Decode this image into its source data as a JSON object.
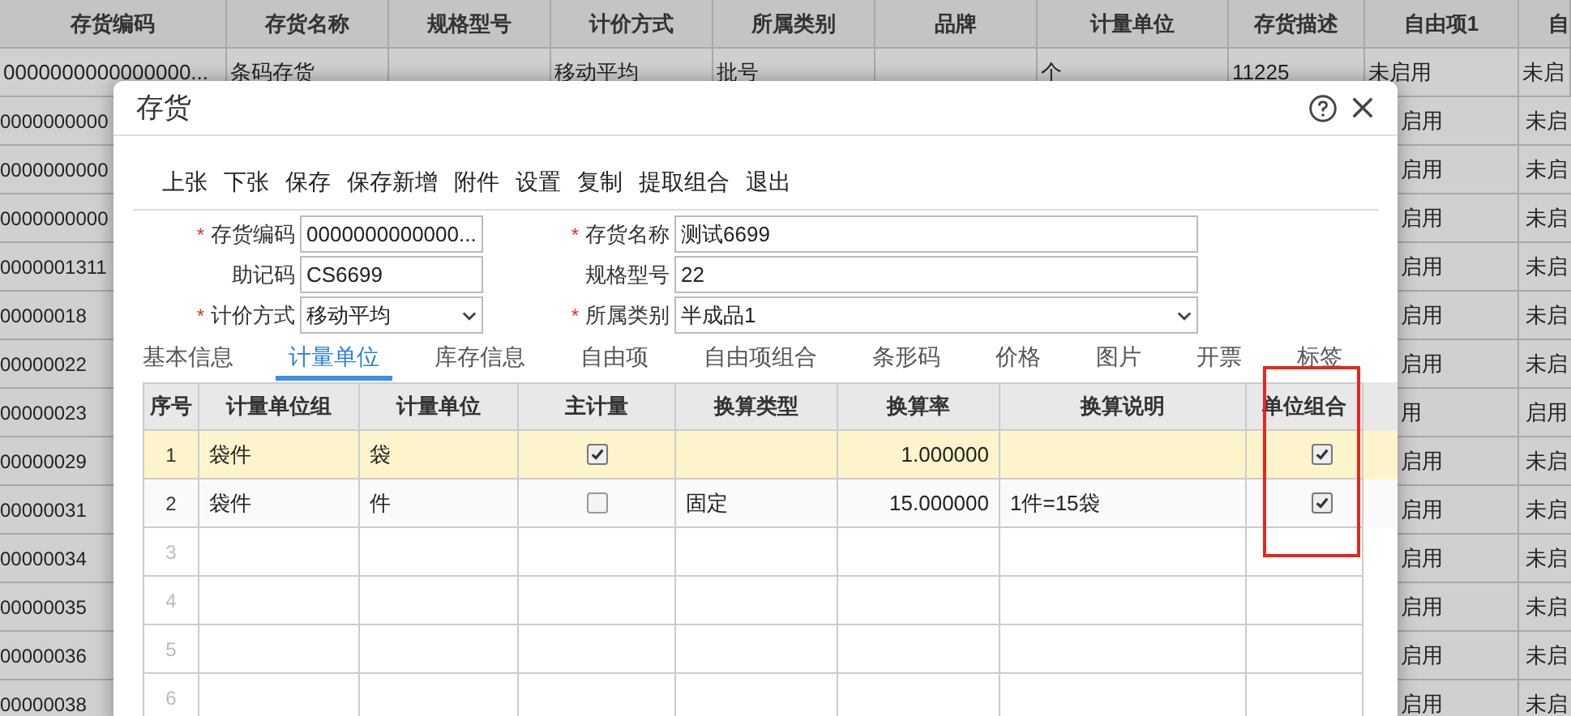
{
  "background_table": {
    "columns": [
      "存货编码",
      "存货名称",
      "规格型号",
      "计价方式",
      "所属类别",
      "品牌",
      "计量单位",
      "存货描述",
      "自由项1",
      "自"
    ],
    "first_row": {
      "code": "0000000000000000...",
      "name": "条码存货",
      "pricing_method": "移动平均",
      "category": "批号",
      "unit": "个",
      "description": "11225",
      "free_item_1": "未启用",
      "column_10": "未启"
    },
    "rows": [
      {
        "code": "0000000000",
        "free_item_1": "启用",
        "column_10": "未启"
      },
      {
        "code": "0000000000",
        "free_item_1": "启用",
        "column_10": "未启"
      },
      {
        "code": "0000000000",
        "free_item_1": "启用",
        "column_10": "未启"
      },
      {
        "code": "0000001311",
        "free_item_1": "启用",
        "column_10": "未启"
      },
      {
        "code": "00000018",
        "free_item_1": "启用",
        "column_10": "未启"
      },
      {
        "code": "00000022",
        "free_item_1": "启用",
        "column_10": "未启"
      },
      {
        "code": "00000023",
        "free_item_1": "用",
        "column_10": "启用"
      },
      {
        "code": "00000029",
        "free_item_1": "启用",
        "column_10": "未启"
      },
      {
        "code": "00000031",
        "free_item_1": "启用",
        "column_10": "未启"
      },
      {
        "code": "00000034",
        "free_item_1": "启用",
        "column_10": "未启"
      },
      {
        "code": "00000035",
        "free_item_1": "启用",
        "column_10": "未启"
      },
      {
        "code": "00000036",
        "free_item_1": "启用",
        "column_10": "未启"
      },
      {
        "code": "00000038",
        "free_item_1": "启用",
        "column_10": "未启"
      }
    ]
  },
  "dialog": {
    "title": "存货",
    "toolbar": [
      "上张",
      "下张",
      "保存",
      "保存新增",
      "附件",
      "设置",
      "复制",
      "提取组合",
      "退出"
    ],
    "fields": [
      {
        "label": "存货编码",
        "required_mark": "*",
        "value": "0000000000000...",
        "kind": "text"
      },
      {
        "label": "存货名称",
        "required_mark": "*",
        "value": "测试6699",
        "kind": "text"
      },
      {
        "label": "助记码",
        "value": "CS6699",
        "kind": "text"
      },
      {
        "label": "规格型号",
        "value": "22",
        "kind": "text"
      },
      {
        "label": "计价方式",
        "required_mark": "*",
        "value": "移动平均",
        "kind": "select"
      },
      {
        "label": "所属类别",
        "required_mark": "*",
        "value": "半成品1",
        "kind": "select"
      }
    ],
    "tabs": [
      {
        "label": "基本信息",
        "selected": false
      },
      {
        "label": "计量单位",
        "selected": true
      },
      {
        "label": "库存信息",
        "selected": false
      },
      {
        "label": "自由项",
        "selected": false
      },
      {
        "label": "自由项组合",
        "selected": false
      },
      {
        "label": "条形码",
        "selected": false
      },
      {
        "label": "价格",
        "selected": false
      },
      {
        "label": "图片",
        "selected": false
      },
      {
        "label": "开票",
        "selected": false
      },
      {
        "label": "标签",
        "selected": false
      }
    ],
    "grid": {
      "columns": [
        "序号",
        "计量单位组",
        "计量单位",
        "主计量",
        "换算类型",
        "换算率",
        "换算说明",
        "单位组合"
      ],
      "rows": [
        {
          "index": "1",
          "group": "袋件",
          "unit": "袋",
          "main": true,
          "rate": "1.000000",
          "combined": true,
          "selected": true
        },
        {
          "index": "2",
          "group": "袋件",
          "unit": "件",
          "main": false,
          "conversion_type": "固定",
          "rate": "15.000000",
          "description": "1件=15袋",
          "combined": true,
          "selected": false
        }
      ],
      "empty_rows": [
        "3",
        "4",
        "5",
        "6"
      ]
    }
  }
}
